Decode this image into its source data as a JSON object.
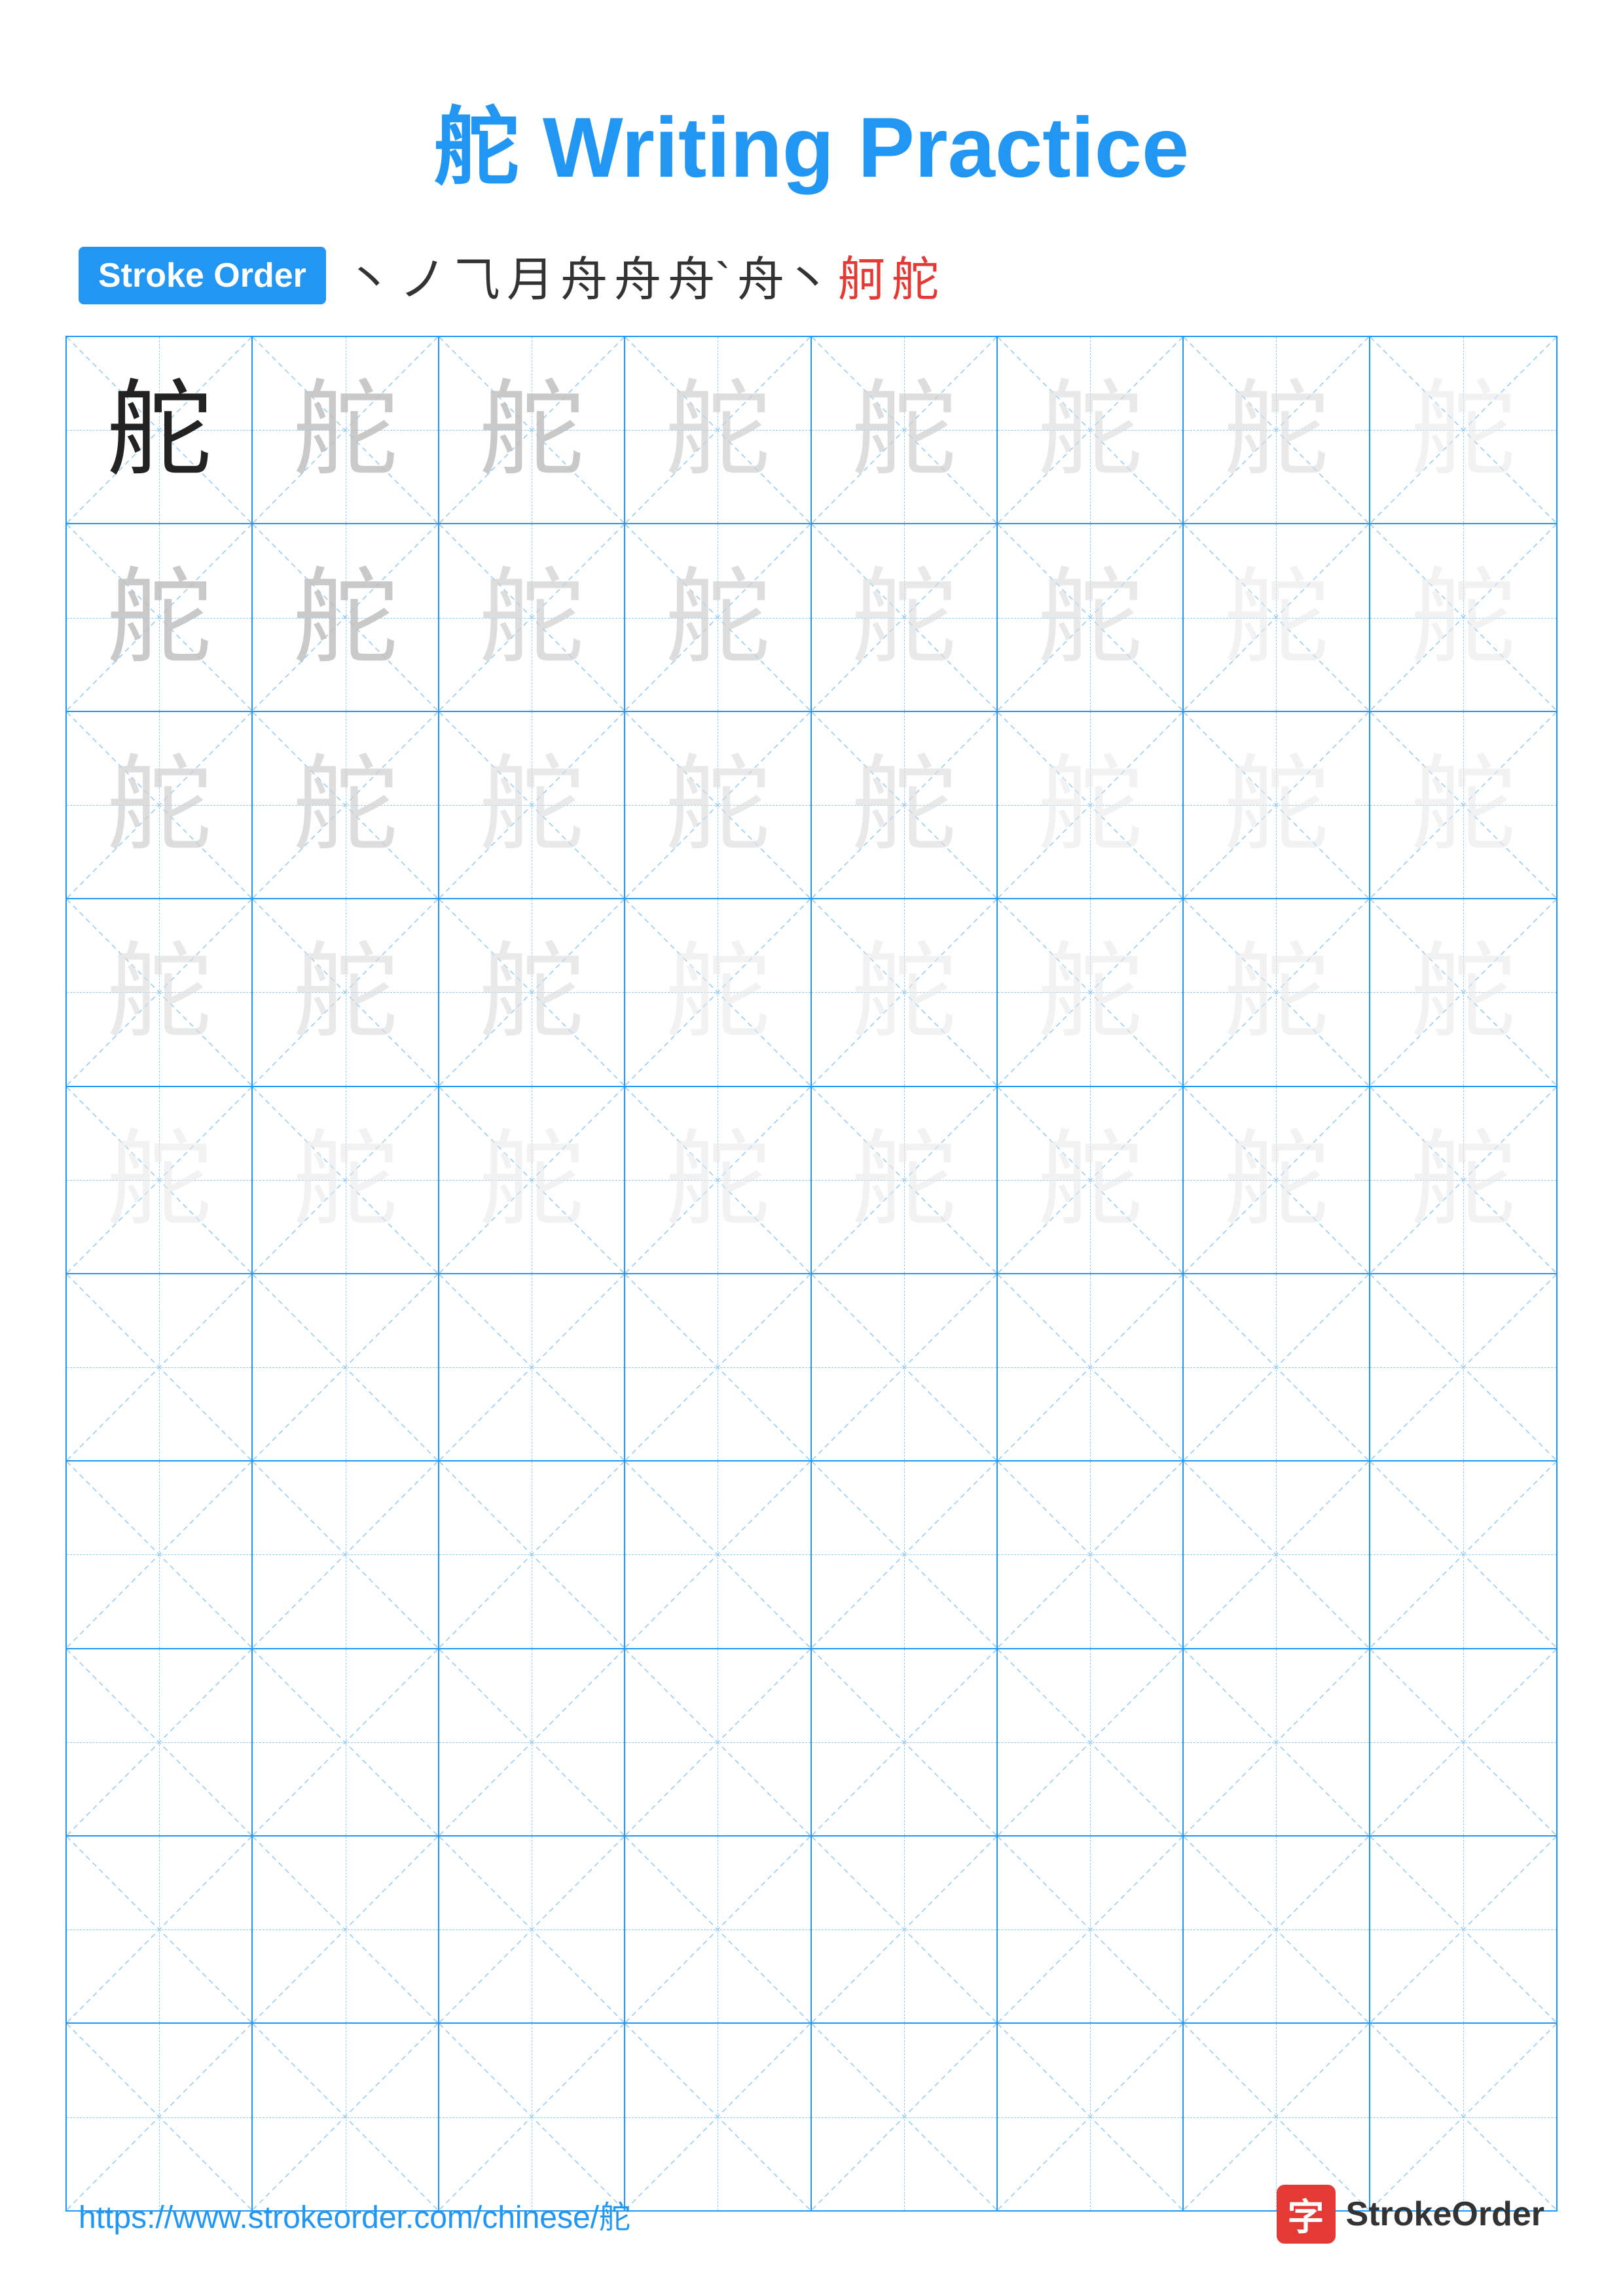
{
  "title": {
    "char": "舵",
    "label": "Writing Practice",
    "full": "舵 Writing Practice"
  },
  "stroke_order": {
    "badge": "Stroke Order",
    "strokes": [
      "丶",
      "ノ",
      "⺄",
      "月",
      "舟",
      "舟",
      "舟`",
      "舟丶",
      "舸",
      "舵"
    ]
  },
  "grid": {
    "rows": 10,
    "cols": 8,
    "char": "舵"
  },
  "footer": {
    "url": "https://www.strokeorder.com/chinese/舵",
    "logo_text": "StrokeOrder",
    "logo_icon": "字"
  }
}
